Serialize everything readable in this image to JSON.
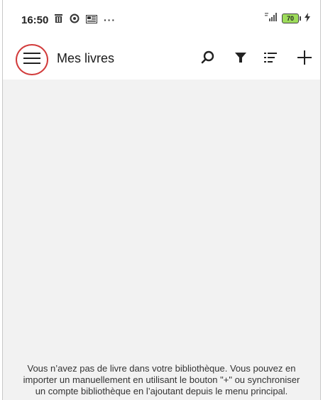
{
  "status_bar": {
    "time": "16:50",
    "overflow": "···",
    "battery_level": "70",
    "left_icons": [
      "trash-icon",
      "sync-icon",
      "notification-icon"
    ],
    "right_icons": [
      "signal-icon",
      "battery-icon",
      "charging-icon"
    ]
  },
  "app_bar": {
    "title": "Mes livres",
    "actions": [
      "search-icon",
      "filter-icon",
      "list-icon",
      "add-icon"
    ]
  },
  "main": {
    "empty_message": "Vous n’avez pas de livre dans votre bibliothèque. Vous pouvez en importer un manuellement en utilisant le bouton \"+\" ou synchroniser un compte bibliothèque en l’ajoutant depuis le menu principal."
  },
  "colors": {
    "highlight_circle": "#d23b3b",
    "content_background": "#f2f2f2"
  }
}
